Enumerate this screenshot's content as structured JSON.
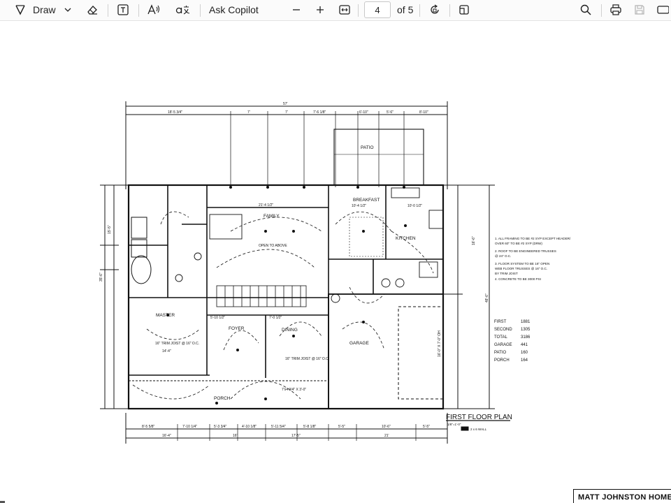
{
  "toolbar": {
    "draw_label": "Draw",
    "ask_copilot_label": "Ask Copilot",
    "page_current": "4",
    "page_total_label": "of 5"
  },
  "document": {
    "plan_title": "FIRST FLOOR PLAN",
    "scale_note": "1/8\"=1'-0\"",
    "wall_note": "2 x 6 WALL",
    "company": "MATT JOHNSTON HOMES",
    "rooms": {
      "patio": "PATIO",
      "breakfast": "BREAKFAST",
      "kitchen": "KITCHEN",
      "family": "FAMILY",
      "master": "MASTER",
      "foyer": "FOYER",
      "dining": "DINING",
      "garage": "GARAGE",
      "porch": "PORCH",
      "open_to_above": "OPEN TO ABOVE"
    },
    "notes": [
      "1. ALL FRAMING TO BE #2 SYP EXCEPT HEADER/",
      "   OVER 60\" TO BE #2 SYP (DRW)",
      "2. ROOF TO BE ENGINEERED TRUSSES",
      "   @ 24\" O.C.",
      "3. FLOOR SYSTEM TO BE 16\" OPEN",
      "   WEB FLOOR TRUSSES @ 16\" O.C.",
      "   BY TRIM JOIST",
      "4. CONCRETE TO BE 3000 PSI"
    ],
    "areas": [
      {
        "label": "FIRST",
        "value": "1881"
      },
      {
        "label": "SECOND",
        "value": "1305"
      },
      {
        "label": "TOTAL",
        "value": "3186"
      },
      {
        "label": "GARAGE",
        "value": "441"
      },
      {
        "label": "PATIO",
        "value": "160"
      },
      {
        "label": "PORCH",
        "value": "164"
      }
    ],
    "dims": {
      "overall_top": "57'",
      "top_1": "18'-5 3/4\"",
      "top_2": "7'",
      "top_3": "7'",
      "top_4": "7'-6 1/8\"",
      "top_5": "6'-10\"",
      "top_6": "5'-6\"",
      "top_7": "8'-10\"",
      "bot_1": "8'-5 5/8\"",
      "bot_2": "7'-10 1/4\"",
      "bot_3": "5'-3 3/4\"",
      "bot_4": "4'-10 1/8\"",
      "bot_5": "5'-11 5/4\"",
      "bot_6": "5'-8 1/8\"",
      "bot_7": "5'-5\"",
      "bot_8": "10'-6\"",
      "bot_9": "5'-5\"",
      "bot_total_1": "16'-4\"",
      "bot_total_2": "16'",
      "bot_total_3": "17'-5\"",
      "bot_total_4": "21'",
      "family_width": "21'-4 1/2\"",
      "breakfast_width": "10'-4 1/2\"",
      "kitchen_width": "10'-0 1/2\"",
      "foyer_width": "5'-10 1/2\"",
      "dining_width": "7'-0 1/2\"",
      "master_width": "14'-4\"",
      "left_1": "15'-5\"",
      "left_2": "35'-6\"",
      "right_1": "16'-6\"",
      "right_2": "48'-6\"",
      "garage_header": "16'-0\" X 7'-0\" OH",
      "master_joist": "16\" TRIM JOIST @ 16\" O.C.",
      "dining_joist": "16\" TRIM JOIST @ 16\" O.C.",
      "porch_beam": "7'x4 3/4\" X 3'-0\""
    }
  }
}
